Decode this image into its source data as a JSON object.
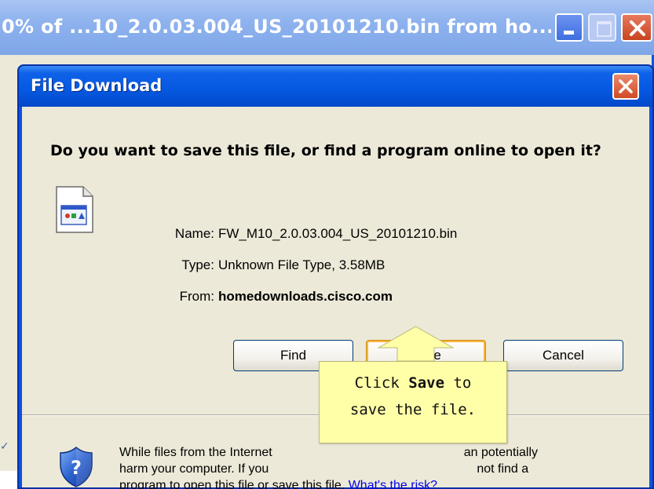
{
  "background_window": {
    "title": "0% of ...10_2.0.03.004_US_20101210.bin from ho..."
  },
  "dialog": {
    "title": "File Download",
    "question": "Do you want to save this file, or find a program online to open it?",
    "fields": {
      "name_label": "Name:",
      "name_value": "FW_M10_2.0.03.004_US_20101210.bin",
      "type_label": "Type:",
      "type_value": "Unknown File Type, 3.58MB",
      "from_label": "From:",
      "from_value": "homedownloads.cisco.com"
    },
    "buttons": {
      "find": "Find",
      "save": "Save",
      "cancel": "Cancel"
    },
    "warning": {
      "line1": "While files from the Internet",
      "line1_end": "an potentially",
      "line2": "harm your computer. If you",
      "line2_end": "not find a",
      "line3": "program to open this file or save this file.",
      "risk_link": "What's the risk?"
    }
  },
  "callout": {
    "prefix": "Click",
    "emphasis": "Save",
    "suffix": "to",
    "line2": "save the file."
  },
  "colors": {
    "xp_blue": "#0a53e3",
    "dialog_face": "#ece9d8",
    "callout_bg": "#ffffa8",
    "save_focus": "#f8b33c",
    "link": "#0000ee"
  }
}
